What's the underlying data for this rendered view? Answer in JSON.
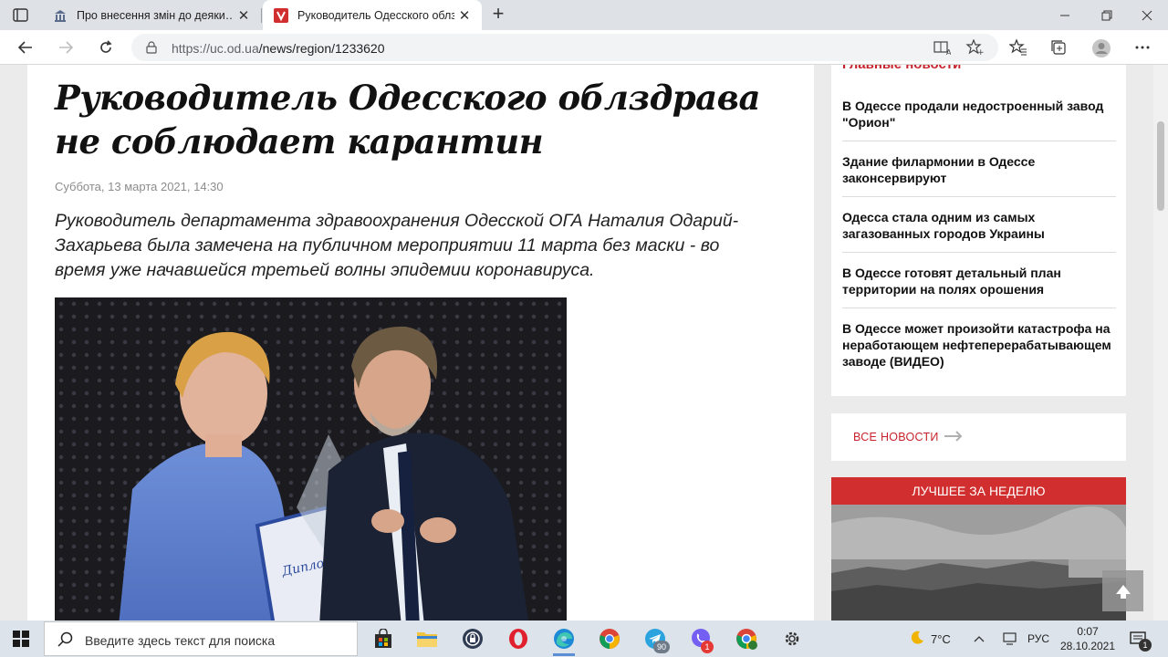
{
  "browser": {
    "tabs": [
      {
        "title": "Про внесення змін до деяки…",
        "active": false
      },
      {
        "title": "Руководитель Одесского облзд",
        "active": true
      }
    ],
    "url_host": "https://uc.od.ua",
    "url_path": "/news/region/1233620"
  },
  "article": {
    "headline": "Руководитель Одесского облздрава не соблюдает карантин",
    "date": "Суббота, 13 марта 2021, 14:30",
    "lead": "Руководитель департамента здравоохранения Одесской ОГА Наталия Одарий-Захарьева была замечена на публичном мероприятии 11 марта без маски - во время уже начавшейся третьей волны эпидемии коронавируса.",
    "photo_caption_text": "Диплом"
  },
  "sidebar": {
    "heading": "Главные новости",
    "news": [
      "В Одессе продали недостроенный завод \"Орион\"",
      "Здание филармонии в Одессе законсервируют",
      "Одесса стала одним из самых загазованных городов Украины",
      "В Одессе готовят детальный план территории на полях орошения",
      "В Одессе может произойти катастрофа на неработающем нефтеперерабатывающем заводе (ВИДЕО)"
    ],
    "all_news_label": "ВСЕ НОВОСТИ",
    "best_week_label": "ЛУЧШЕЕ ЗА НЕДЕЛЮ"
  },
  "taskbar": {
    "search_placeholder": "Введите здесь текст для поиска",
    "weather": "7°C",
    "language": "РУС",
    "time": "0:07",
    "date": "28.10.2021",
    "telegram_badge": "90",
    "viber_badge": "1",
    "notifications_badge": "1"
  },
  "colors": {
    "accent_red": "#c8232c",
    "best_bar": "#d12f2f",
    "taskbar": "#dde3ea"
  }
}
